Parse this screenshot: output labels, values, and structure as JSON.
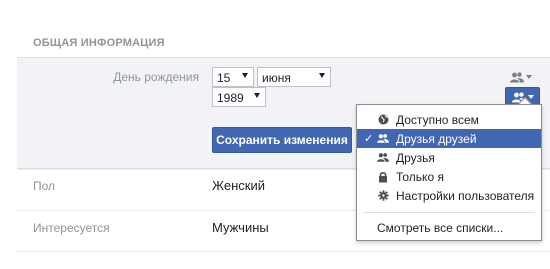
{
  "section": {
    "title": "ОБЩАЯ ИНФОРМАЦИЯ"
  },
  "birthday": {
    "label": "День рождения",
    "day": "15",
    "month": "июня",
    "year": "1989"
  },
  "save_button": "Сохранить изменения",
  "fields": [
    {
      "label": "Пол",
      "value": "Женский"
    },
    {
      "label": "Интересуется",
      "value": "Мужчины"
    }
  ],
  "audience_menu": {
    "items": [
      {
        "label": "Доступно всем",
        "icon": "globe-icon"
      },
      {
        "label": "Друзья друзей",
        "icon": "friends-of-friends-icon",
        "selected": true
      },
      {
        "label": "Друзья",
        "icon": "friends-icon"
      },
      {
        "label": "Только я",
        "icon": "lock-icon"
      },
      {
        "label": "Настройки пользователя",
        "icon": "gear-icon"
      }
    ],
    "see_all": "Смотреть все списки..."
  },
  "colors": {
    "accent": "#4267b2",
    "panel_bg": "#f2f3f6",
    "muted_text": "#90949c"
  }
}
